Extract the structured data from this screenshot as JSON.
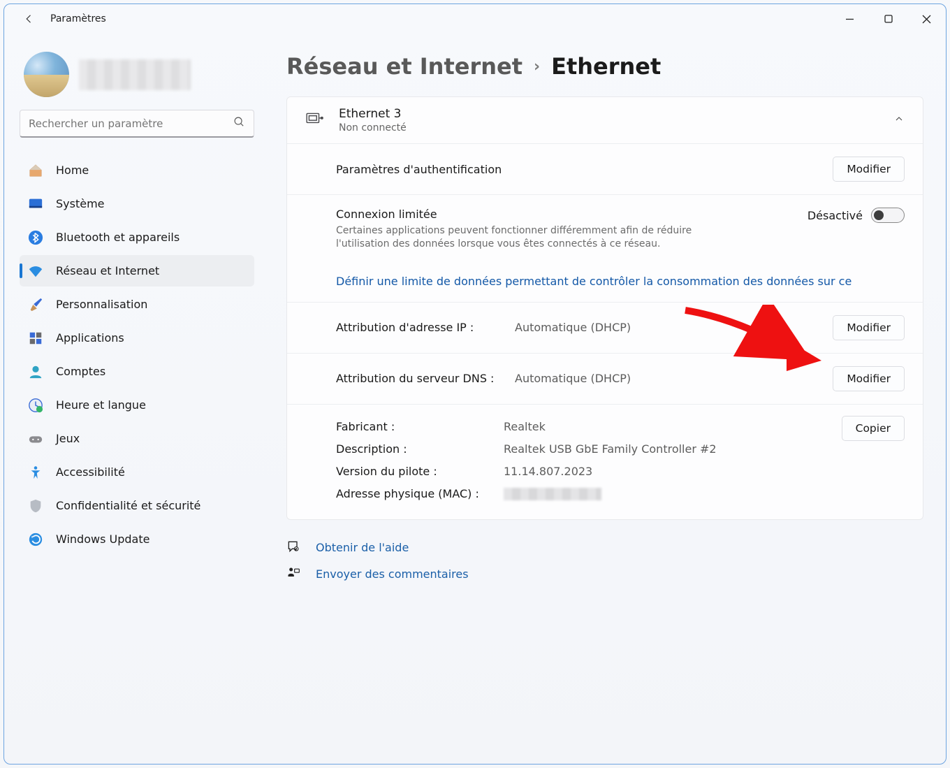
{
  "app": {
    "title": "Paramètres"
  },
  "search": {
    "placeholder": "Rechercher un paramètre"
  },
  "nav": {
    "items": [
      {
        "label": "Home"
      },
      {
        "label": "Système"
      },
      {
        "label": "Bluetooth et appareils"
      },
      {
        "label": "Réseau et Internet"
      },
      {
        "label": "Personnalisation"
      },
      {
        "label": "Applications"
      },
      {
        "label": "Comptes"
      },
      {
        "label": "Heure et langue"
      },
      {
        "label": "Jeux"
      },
      {
        "label": "Accessibilité"
      },
      {
        "label": "Confidentialité et sécurité"
      },
      {
        "label": "Windows Update"
      }
    ]
  },
  "breadcrumb": {
    "parent": "Réseau et Internet",
    "current": "Ethernet"
  },
  "ethernet": {
    "name": "Ethernet 3",
    "status": "Non connecté",
    "auth": {
      "label": "Paramètres d'authentification",
      "button": "Modifier"
    },
    "metered": {
      "title": "Connexion limitée",
      "description": "Certaines applications peuvent fonctionner différemment afin de réduire l'utilisation des données lorsque vous êtes connectés à ce réseau.",
      "toggle_label": "Désactivé",
      "link": "Définir une limite de données permettant de contrôler la consommation des données sur ce"
    },
    "ip": {
      "label": "Attribution d'adresse IP :",
      "value": "Automatique (DHCP)",
      "button": "Modifier"
    },
    "dns": {
      "label": "Attribution du serveur DNS :",
      "value": "Automatique (DHCP)",
      "button": "Modifier"
    },
    "info": {
      "manufacturer_label": "Fabricant :",
      "manufacturer": "Realtek",
      "description_label": "Description :",
      "description": "Realtek USB GbE Family Controller #2",
      "driver_label": "Version du pilote :",
      "driver": "11.14.807.2023",
      "mac_label": "Adresse physique (MAC) :",
      "copy_button": "Copier"
    }
  },
  "help": {
    "get_help": "Obtenir de l'aide",
    "feedback": "Envoyer des commentaires"
  }
}
